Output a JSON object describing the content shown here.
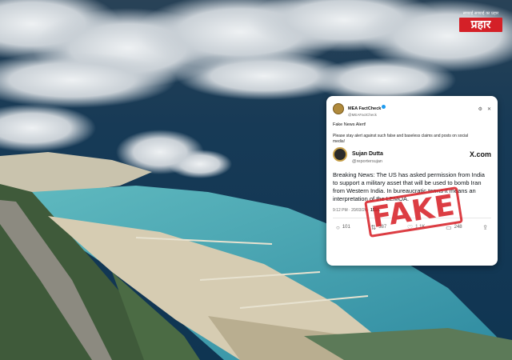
{
  "logo": {
    "tagline": "सच्चाई सच्चाई का प्रहार",
    "name": "प्रहार"
  },
  "source": {
    "name": "MEA FactCheck",
    "handle": "@MEAFactCheck",
    "header_icons": [
      "gear-icon",
      "dismiss-icon"
    ]
  },
  "alert": {
    "title": "Fake News Alert!",
    "body": "Please stay alert against such false and baseless claims and posts on social media!"
  },
  "embedded_post": {
    "author": "Sujan Dutta",
    "handle": "@reportersujan",
    "platform": "X.com",
    "text": "Breaking News: The US has asked permission from India to support a military asset that will be used to bomb Iran from Western India. In bureaucratic terms it means an interpretation of the LEMOA.",
    "time": "9:12 PM · 20/03/26 ·",
    "views": "151K",
    "stats": {
      "replies": "101",
      "reposts": "387",
      "likes": "1.1K",
      "bookmarks": "248"
    }
  },
  "stamp": {
    "label": "FAKE",
    "color": "#d8232a"
  }
}
